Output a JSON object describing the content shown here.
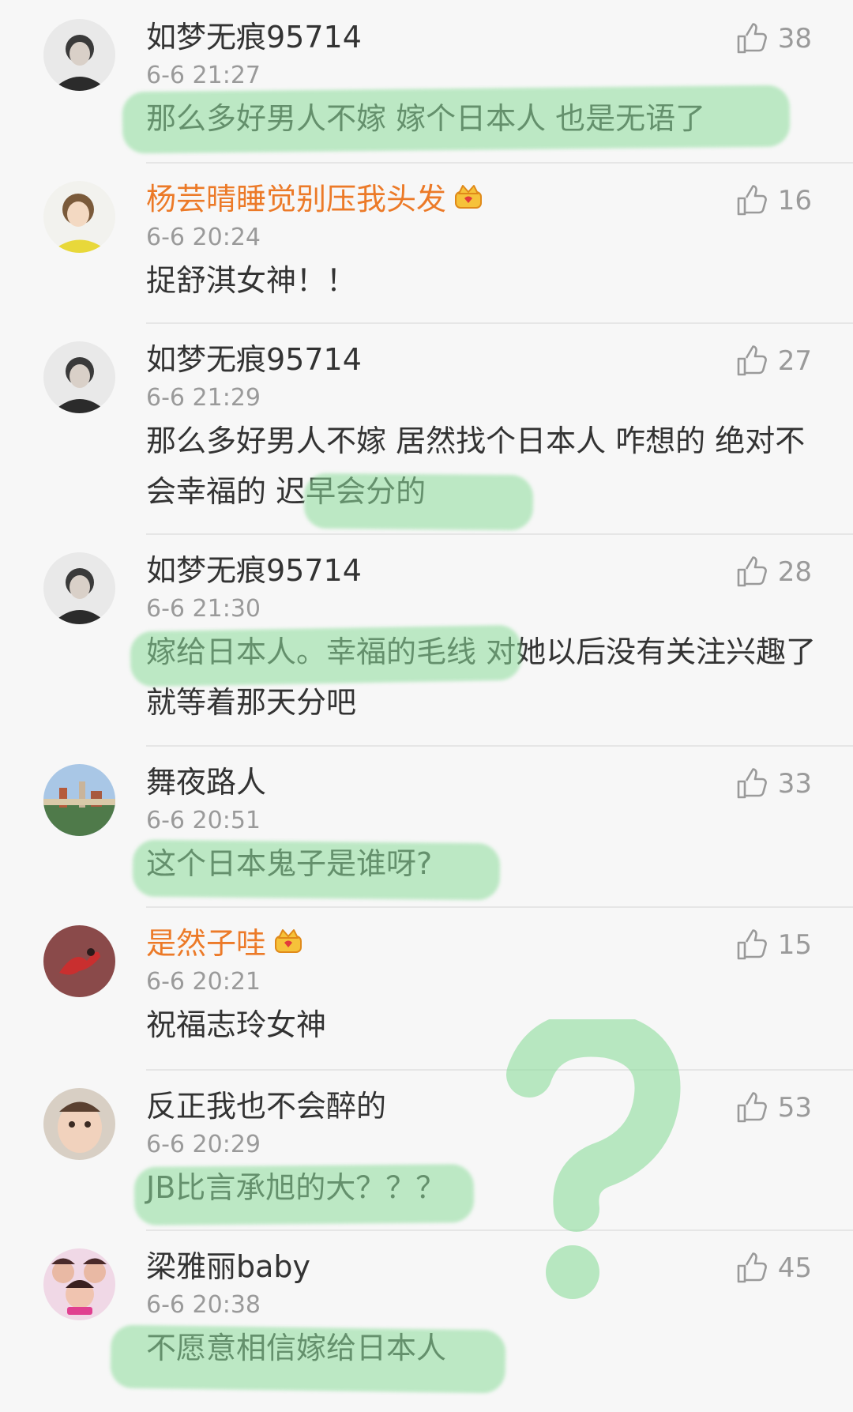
{
  "comments": [
    {
      "username": "如梦无痕95714",
      "time": "6-6 21:27",
      "likes": "38",
      "text": "那么多好男人不嫁 嫁个日本人 也是无语了",
      "vip": false,
      "avatar_icon": "man-portrait-avatar"
    },
    {
      "username": "杨芸晴睡觉别压我头发",
      "time": "6-6 20:24",
      "likes": "16",
      "text": "捉舒淇女神！！",
      "vip": true,
      "avatar_icon": "girl-portrait-avatar"
    },
    {
      "username": "如梦无痕95714",
      "time": "6-6 21:29",
      "likes": "27",
      "text": "那么多好男人不嫁 居然找个日本人 咋想的 绝对不会幸福的 迟早会分的",
      "vip": false,
      "avatar_icon": "man-portrait-avatar"
    },
    {
      "username": "如梦无痕95714",
      "time": "6-6 21:30",
      "likes": "28",
      "text": "嫁给日本人。幸福的毛线 对她以后没有关注兴趣了 就等着那天分吧",
      "vip": false,
      "avatar_icon": "man-portrait-avatar"
    },
    {
      "username": "舞夜路人",
      "time": "6-6 20:51",
      "likes": "33",
      "text": "这个日本鬼子是谁呀?",
      "vip": false,
      "avatar_icon": "city-landscape-avatar"
    },
    {
      "username": "是然子哇",
      "time": "6-6 20:21",
      "likes": "15",
      "text": "祝福志玲女神",
      "vip": true,
      "avatar_icon": "dragon-avatar"
    },
    {
      "username": "反正我也不会醉的",
      "time": "6-6 20:29",
      "likes": "53",
      "text": "JB比言承旭的大？？？",
      "vip": false,
      "avatar_icon": "baby-avatar"
    },
    {
      "username": "梁雅丽baby",
      "time": "6-6 20:38",
      "likes": "45",
      "text": "不愿意相信嫁给日本人",
      "vip": false,
      "avatar_icon": "group-photo-avatar"
    }
  ],
  "colors": {
    "vip_name": "#ec7a28",
    "highlight": "#8cdc9b",
    "text": "#333333",
    "meta": "#9a9a9a"
  }
}
